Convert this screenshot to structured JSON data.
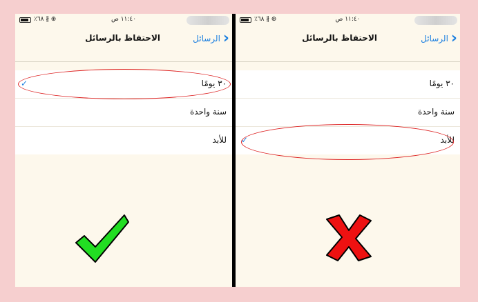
{
  "panels": [
    {
      "status": {
        "left": "٪٦٨ ∦ ⊕",
        "time": "١١:٤٠ ص"
      },
      "nav": {
        "title": "الاحتفاظ بالرسائل",
        "back_label": "الرسائل"
      },
      "options": [
        {
          "label": "٣٠ يومًا",
          "checked": true,
          "highlighted": true
        },
        {
          "label": "سنة واحدة",
          "checked": false,
          "highlighted": false
        },
        {
          "label": "للأبد",
          "checked": false,
          "highlighted": false
        }
      ],
      "verdict_icon": "green-checkmark-icon"
    },
    {
      "status": {
        "left": "٪٦٨ ∦ ⊕",
        "time": "١١:٤٠ ص"
      },
      "nav": {
        "title": "الاحتفاظ بالرسائل",
        "back_label": "الرسائل"
      },
      "options": [
        {
          "label": "٣٠ يومًا",
          "checked": false,
          "highlighted": false
        },
        {
          "label": "سنة واحدة",
          "checked": false,
          "highlighted": false
        },
        {
          "label": "للأبد",
          "checked": true,
          "highlighted": true
        }
      ],
      "verdict_icon": "red-x-icon"
    }
  ],
  "check_glyph": "✓",
  "colors": {
    "background": "#f6cfcf",
    "accent": "#1a7fe0",
    "highlight": "#dd2222",
    "good": "#22dd22",
    "bad": "#ee1111"
  }
}
